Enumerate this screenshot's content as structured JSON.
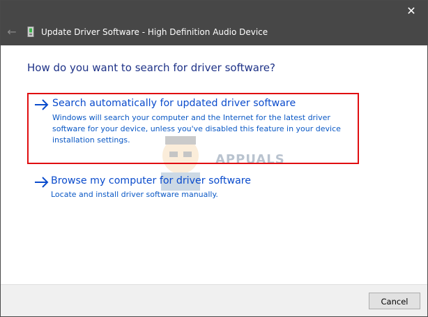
{
  "window": {
    "title": "Update Driver Software - High Definition Audio Device",
    "close_glyph": "✕",
    "back_glyph": "←"
  },
  "heading": "How do you want to search for driver software?",
  "options": [
    {
      "title": "Search automatically for updated driver software",
      "description": "Windows will search your computer and the Internet for the latest driver software for your device, unless you've disabled this feature in your device installation settings.",
      "selected": true
    },
    {
      "title": "Browse my computer for driver software",
      "description": "Locate and install driver software manually.",
      "selected": false
    }
  ],
  "watermark": {
    "brand": "APPUALS"
  },
  "footer": {
    "cancel_label": "Cancel"
  },
  "colors": {
    "titlebar": "#474747",
    "heading": "#1e3287",
    "link": "#0a4bcc",
    "highlight": "#e00d10"
  },
  "icons": {
    "back": "arrow-left-icon",
    "device": "device-icon",
    "option": "arrow-right-icon",
    "close": "close-icon"
  }
}
